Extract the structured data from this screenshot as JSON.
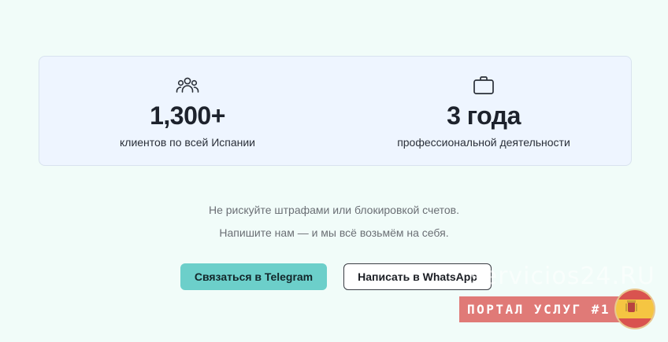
{
  "stats": [
    {
      "icon": "users-icon",
      "value": "1,300+",
      "caption": "клиентов по всей Испании"
    },
    {
      "icon": "briefcase-icon",
      "value": "3 года",
      "caption": "профессиональной деятельности"
    }
  ],
  "notes": {
    "line1": "Не рискуйте штрафами или блокировкой счетов.",
    "line2": "Напишите нам — и мы всё возьмём на себя."
  },
  "buttons": {
    "telegram_label": "Связаться в Telegram",
    "whatsapp_label": "Написать в WhatsApp"
  },
  "watermark": {
    "site": "servicios24.RU",
    "banner": "ПОРТАЛ УСЛУГ #1"
  },
  "colors": {
    "page_background": "#f1fcf9",
    "card_background": "#eef5ff",
    "telegram_button": "#6ccfca",
    "banner": "#e07a77"
  }
}
